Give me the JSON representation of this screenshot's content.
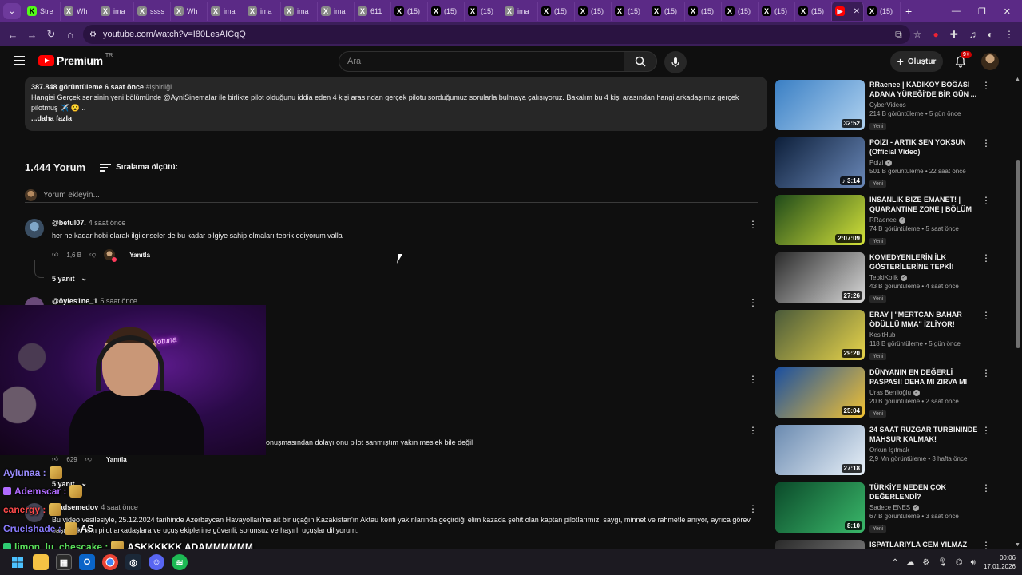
{
  "browser": {
    "tabs": [
      {
        "label": "Stre",
        "fav": "K",
        "color": "#53fc18"
      },
      {
        "label": "Wh",
        "fav": "X",
        "color": "#888"
      },
      {
        "label": "ima",
        "fav": "X",
        "color": "#888"
      },
      {
        "label": "ssss",
        "fav": "X",
        "color": "#888"
      },
      {
        "label": "Wh",
        "fav": "X",
        "color": "#888"
      },
      {
        "label": "ima",
        "fav": "X",
        "color": "#888"
      },
      {
        "label": "ima",
        "fav": "X",
        "color": "#888"
      },
      {
        "label": "ima",
        "fav": "X",
        "color": "#888"
      },
      {
        "label": "ima",
        "fav": "X",
        "color": "#888"
      },
      {
        "label": "611",
        "fav": "X",
        "color": "#888"
      },
      {
        "label": "(15)",
        "fav": "X",
        "color": "#000"
      },
      {
        "label": "(15)",
        "fav": "X",
        "color": "#000"
      },
      {
        "label": "(15)",
        "fav": "X",
        "color": "#000"
      },
      {
        "label": "ima",
        "fav": "X",
        "color": "#888"
      },
      {
        "label": "(15)",
        "fav": "X",
        "color": "#000"
      },
      {
        "label": "(15)",
        "fav": "X",
        "color": "#000"
      },
      {
        "label": "(15)",
        "fav": "X",
        "color": "#000"
      },
      {
        "label": "(15)",
        "fav": "X",
        "color": "#000"
      },
      {
        "label": "(15)",
        "fav": "X",
        "color": "#000"
      },
      {
        "label": "(15)",
        "fav": "X",
        "color": "#000"
      },
      {
        "label": "(15)",
        "fav": "X",
        "color": "#000"
      },
      {
        "label": "(15)",
        "fav": "X",
        "color": "#000"
      }
    ],
    "active_tab_after": "(15)",
    "url": "youtube.com/watch?v=I80LesAICqQ",
    "new_tab": "+"
  },
  "youtube": {
    "logo_word": "Premium",
    "logo_region": "TR",
    "search_placeholder": "Ara",
    "create_label": "Oluştur",
    "notif_badge": "9+",
    "description": {
      "meta": "387.848 görüntüleme  6 saat önce",
      "hashtag": "#işbirliği",
      "text": "Hangisi Gerçek serisinin yeni bölümünde @AyniSinemalar ile birlikte pilot olduğunu iddia eden 4 kişi arasından gerçek pilotu sorduğumuz sorularla bulmaya çalışıyoruz. Bakalım bu 4 kişi arasından hangi arkadaşımız gerçek pilotmuş ✈️ 😮 ..",
      "more": "...daha fazla"
    },
    "comments_count": "1.444 Yorum",
    "sort_label": "Sıralama ölçütü:",
    "add_comment_placeholder": "Yorum ekleyin...",
    "comments": [
      {
        "author": "@betul07.",
        "time": "4 saat önce",
        "text": "her ne kadar hobi olarak ilgilenseler de bu kadar bilgiye sahip olmaları tebrik ediyorum valla",
        "likes": "1,6 B",
        "reply_label": "Yanıtla",
        "replies": "5 yanıt"
      },
      {
        "author": "@öyles1ne_1",
        "time": "5 saat önce",
        "text": "onuşmasından dolayı onu pilot sanmıştım yakın meslek bile değil",
        "likes": "629",
        "reply_label": "Yanıtla",
        "replies": "5 yanıt"
      },
      {
        "author": "@adsemedov",
        "time": "4 saat önce",
        "text": "Bu video vesilesiyle, 25.12.2024 tarihinde Azerbaycan Havayolları'na ait bir uçağın Kazakistan'ın Aktau kenti yakınlarında geçirdiği elim kazada şehit olan kaptan pilotlarımızı saygı, minnet ve rahmetle anıyor, ayrıca görev başındaki tüm pilot arkadaşlara ve uçuş ekiplerine güvenli, sorunsuz ve hayırlı uçuşlar diliyorum."
      }
    ],
    "sidebar": [
      {
        "title": "RRaenee | KADIKÖY BOĞASI ADANA YÜREĞİ'DE BİR GÜN ...",
        "channel": "CyberVideos",
        "verified": false,
        "stats": "214 B görüntüleme • 5 gün önce",
        "badge": "Yeni",
        "duration": "32:52",
        "thumb": [
          "#3a7fc4",
          "#b0d2f0"
        ]
      },
      {
        "title": "POIZI - ARTIK SEN YOKSUN (Official Video)",
        "channel": "Poizi",
        "verified": true,
        "stats": "501 B görüntüleme • 22 saat önce",
        "badge": "Yeni",
        "duration": "♪ 3:14",
        "thumb": [
          "#0d1f3a",
          "#6a88b8"
        ]
      },
      {
        "title": "İNSANLIK BİZE EMANET! | QUARANTINE ZONE | BÖLÜM 1|",
        "channel": "RRaenee",
        "verified": true,
        "stats": "74 B görüntüleme • 5 saat önce",
        "badge": "Yeni",
        "duration": "2:07:09",
        "thumb": [
          "#1f4a1a",
          "#d4e23a"
        ]
      },
      {
        "title": "KOMEDYENLERİN İLK GÖSTERİLERİNE TEPKİ!",
        "channel": "TepkiKolik",
        "verified": true,
        "stats": "43 B görüntüleme • 4 saat önce",
        "badge": "Yeni",
        "duration": "27:26",
        "thumb": [
          "#2b2b2b",
          "#d9d9d9"
        ]
      },
      {
        "title": "ERAY | \"MERTCAN BAHAR ÖDÜLLÜ MMA\" İZLİYOR!",
        "channel": "KesitHub",
        "verified": false,
        "stats": "118 B görüntüleme • 5 gün önce",
        "badge": "Yeni",
        "duration": "29:20",
        "thumb": [
          "#4a5a3a",
          "#e8d44a"
        ]
      },
      {
        "title": "DÜNYANIN EN DEĞERLİ PASPASI! DEHA MI ZIRVA MI",
        "channel": "Uras Benlioğlu",
        "verified": true,
        "stats": "20 B görüntüleme • 2 saat önce",
        "badge": "Yeni",
        "duration": "25:04",
        "thumb": [
          "#1a4fa0",
          "#f2c233"
        ]
      },
      {
        "title": "24 SAAT RÜZGAR TÜRBİNİNDE MAHSUR KALMAK!",
        "channel": "Orkun Işıtmak",
        "verified": false,
        "stats": "2,9 Mn görüntüleme • 3 hafta önce",
        "badge": "",
        "duration": "27:18",
        "thumb": [
          "#6a8ab0",
          "#e8f0f8"
        ]
      },
      {
        "title": "TÜRKİYE NEDEN ÇOK DEĞERLENDİ?",
        "channel": "Sadece ENES",
        "verified": true,
        "stats": "67 B görüntüleme • 3 saat önce",
        "badge": "Yeni",
        "duration": "8:10",
        "thumb": [
          "#0b4a2a",
          "#3ab86a"
        ]
      },
      {
        "title": "İSPATLARIYLA CEM YILMAZ",
        "channel": "",
        "verified": false,
        "stats": "",
        "badge": "",
        "duration": "",
        "thumb": [
          "#2a2a2a",
          "#888"
        ]
      }
    ],
    "overlay_texts": [
      "IZLIYOR",
      "ADANA'DA 1GÜN",
      "QUARANTINE ZONE",
      "BÖLÜM 1",
      "MASA BİZ!"
    ]
  },
  "stream_chat": [
    {
      "user": "Aylunaa :",
      "color": "#9b8cff",
      "msg": ""
    },
    {
      "user": "Ademscar :",
      "color": "#b06bff",
      "msg": ""
    },
    {
      "user": "canergy :",
      "color": "#ff4a4a",
      "msg": ""
    },
    {
      "user": "Cruelshade :",
      "color": "#8a7cff",
      "msg": "AS"
    },
    {
      "user": "limon_lu_chescake :",
      "color": "#5adf5a",
      "msg": "ASKKKKKK ADAMMMMMM"
    }
  ],
  "webcam_neon": "Kotuna",
  "taskbar": {
    "time": "00:06",
    "date": "17.01.2026"
  },
  "colors": {
    "yt_bg": "#0f0f0f",
    "browser_accent": "#5b2a86",
    "yt_red": "#ff0000"
  }
}
